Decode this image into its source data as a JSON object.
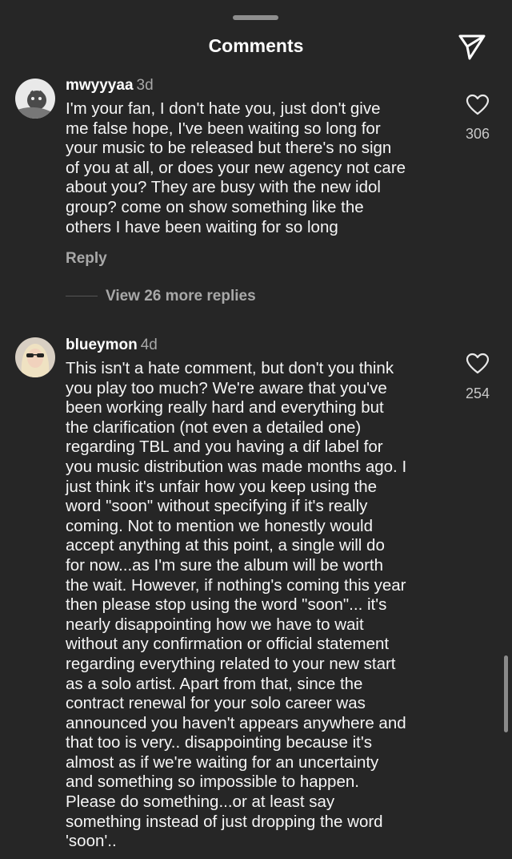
{
  "header": {
    "title": "Comments",
    "share_icon": "send-icon"
  },
  "comments": [
    {
      "username": "mwyyyaa",
      "time": "3d",
      "lines": [
        "I'm your fan, I don't hate you, just don't give",
        "me false hope, I've been waiting so long for",
        "your music to be released but there's no sign",
        "of you at all, or does your new agency not care",
        "about you? They are busy with the new idol",
        "group? come on show something like the",
        "others I have been waiting for so long"
      ],
      "likes": "306",
      "reply_label": "Reply",
      "view_replies": "View 26 more replies"
    },
    {
      "username": "blueymon",
      "time": "4d",
      "lines": [
        "This isn't a hate comment, but don't you think",
        "you play too much? We're aware that you've",
        "been working really hard and everything but",
        "the clarification (not even a detailed one)",
        "regarding TBL and you having a dif label for",
        "you music distribution was made months ago. I",
        "just think it's unfair how you keep using the",
        "word \"soon\" without specifying if it's really",
        "coming. Not to mention we honestly would",
        "accept anything at this point, a single will do",
        "for now...as I'm sure the album will be worth",
        "the wait. However, if nothing's coming this year",
        "then please stop using the word \"soon\"... it's",
        "nearly disappointing how we have to wait",
        "without any confirmation or official statement",
        "regarding everything related to your new start",
        "as a solo artist. Apart from that, since the",
        "contract renewal for your solo career was",
        "announced you haven't appears anywhere and",
        "that too is very.. disappointing because it's",
        "almost as if we're waiting for an uncertainty",
        "and something so impossible to happen.",
        "Please do something...or at least say",
        "something instead of just dropping the word",
        "'soon'.."
      ],
      "likes": "254"
    }
  ],
  "colors": {
    "background": "#262626",
    "text": "#f5f5f5",
    "muted": "#a8a8a8"
  }
}
